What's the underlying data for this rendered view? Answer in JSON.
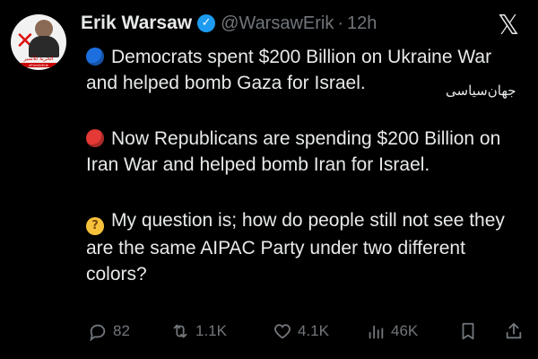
{
  "post": {
    "author_name": "Erik Warsaw",
    "handle": "@WarsawErik",
    "separator": "·",
    "time": "12h",
    "paragraphs": [
      {
        "icon": "blue-circle-icon",
        "text": "Democrats spent $200 Billion on Ukraine War and helped bomb Gaza for Israel."
      },
      {
        "icon": "red-circle-icon",
        "text": "Now Republicans are spending $200 Billion on Iran War and helped bomb Iran for Israel."
      },
      {
        "icon": "thinking-face-icon",
        "text": "My question is; how do people still not see they are the same AIPAC Party under two different colors?"
      }
    ],
    "watermark": "جهان‌سیاسی"
  },
  "metrics": {
    "replies": "82",
    "reposts": "1.1K",
    "likes": "4.1K",
    "views": "46K"
  },
  "avatar": {
    "caption_top": "الحرية للأسير",
    "caption_bottom": "#FreeDrErik"
  },
  "colors": {
    "background": "#000000",
    "text": "#e7e9ea",
    "muted": "#71767b",
    "verified": "#1d9bf0"
  }
}
